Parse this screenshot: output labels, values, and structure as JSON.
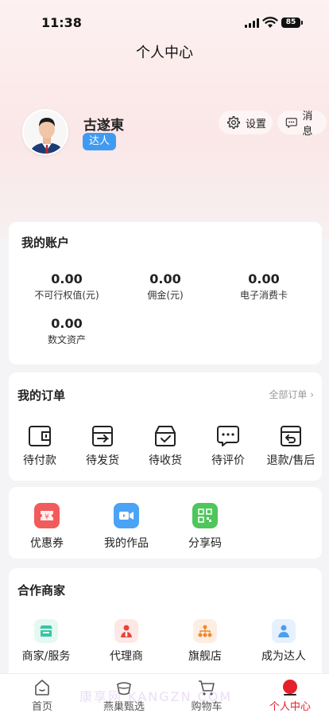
{
  "status_bar": {
    "time": "11:38",
    "battery": "85"
  },
  "page": {
    "title": "个人中心"
  },
  "user": {
    "name": "古遂東",
    "badge": "达人"
  },
  "header_actions": {
    "settings_label": "设置",
    "message_label": "消息"
  },
  "account": {
    "title": "我的账户",
    "items": [
      {
        "value": "0.00",
        "label": "不可行权值(元)"
      },
      {
        "value": "0.00",
        "label": "佣金(元)"
      },
      {
        "value": "0.00",
        "label": "电子消费卡"
      },
      {
        "value": "0.00",
        "label": "数文资产"
      }
    ]
  },
  "orders": {
    "title": "我的订单",
    "all_link": "全部订单",
    "items": [
      {
        "label": "待付款",
        "icon": "wallet-icon"
      },
      {
        "label": "待发货",
        "icon": "box-send-icon"
      },
      {
        "label": "待收货",
        "icon": "box-check-icon"
      },
      {
        "label": "待评价",
        "icon": "comment-icon"
      },
      {
        "label": "退款/售后",
        "icon": "refund-icon"
      }
    ]
  },
  "tools": {
    "items": [
      {
        "label": "优惠券",
        "icon": "coupon-icon",
        "color": "#f25b5b"
      },
      {
        "label": "我的作品",
        "icon": "video-icon",
        "color": "#4aa3f5"
      },
      {
        "label": "分享码",
        "icon": "qrcode-icon",
        "color": "#4fc65b"
      }
    ]
  },
  "partners": {
    "title": "合作商家",
    "items": [
      {
        "label": "商家/服务",
        "icon": "store-icon",
        "color": "#36c6a2"
      },
      {
        "label": "代理商",
        "icon": "agent-icon",
        "color": "#e8443b"
      },
      {
        "label": "旗舰店",
        "icon": "network-icon",
        "color": "#f0892a"
      },
      {
        "label": "成为达人",
        "icon": "person-icon",
        "color": "#4b9ff2"
      }
    ]
  },
  "tabbar": {
    "items": [
      {
        "label": "首页",
        "icon": "home-icon"
      },
      {
        "label": "燕巢甄选",
        "icon": "nest-icon"
      },
      {
        "label": "购物车",
        "icon": "cart-icon"
      },
      {
        "label": "个人中心",
        "icon": "profile-icon"
      }
    ],
    "active_index": 3,
    "active_color": "#e4212b"
  },
  "watermark": "康享网 KANGZN.COM"
}
